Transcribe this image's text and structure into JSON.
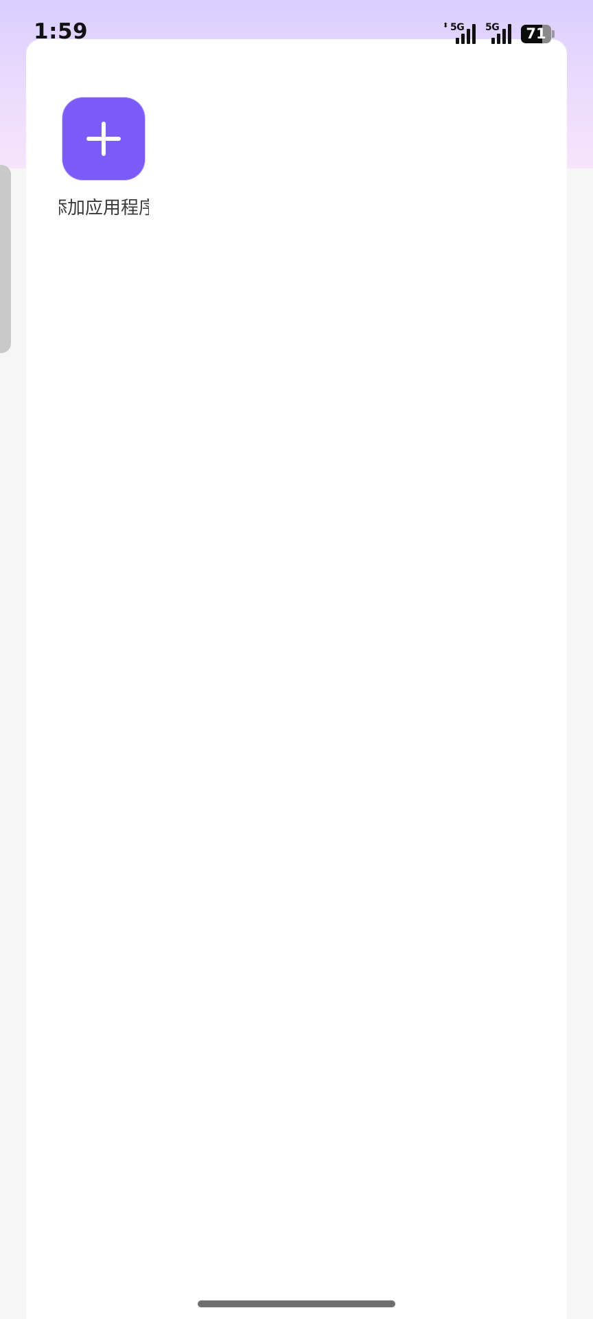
{
  "status_bar": {
    "time": "1:59",
    "sim1": {
      "network": "5G",
      "updown_icon": "arrow-up-down-icon",
      "signal_level": 4
    },
    "sim2": {
      "network": "5G",
      "signal_level": 4
    },
    "battery_level": "71"
  },
  "card": {
    "add_app": {
      "icon": "plus-icon",
      "label": "添加应用程序"
    }
  },
  "colors": {
    "accent": "#7c5cf8",
    "background": "#f6f6f6",
    "card": "#ffffff"
  }
}
